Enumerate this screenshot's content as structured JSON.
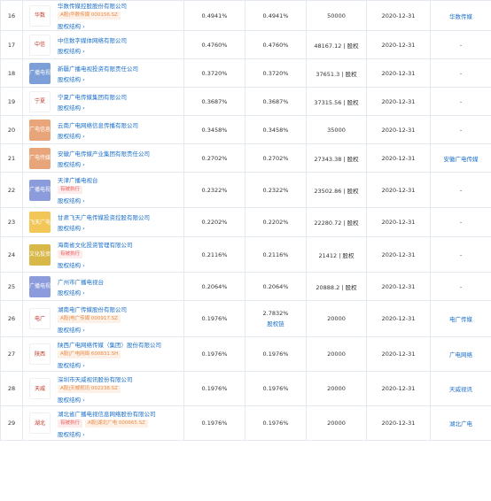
{
  "columns_note": "",
  "rows": [
    {
      "no": "16",
      "logo": "华数",
      "logo_color": "#ffffff",
      "company": "华数传媒控股股份有限公司",
      "tags": [
        {
          "type": "stock",
          "text": "A股|华数传媒 000156.SZ"
        }
      ],
      "chain": "股权结构",
      "ratio1": "0.4941%",
      "ratio2": "0.4941%",
      "ratio2_sub": "",
      "amount": "50000",
      "date": "2020-12-31",
      "brand": "华数传媒"
    },
    {
      "no": "17",
      "logo": "中信",
      "logo_color": "#ffffff",
      "company": "中信数字媒体网络有限公司",
      "tags": [],
      "chain": "股权结构",
      "ratio1": "0.4760%",
      "ratio2": "0.4760%",
      "ratio2_sub": "",
      "amount": "48167.12 | 股权",
      "date": "2020-12-31",
      "brand": "-"
    },
    {
      "no": "18",
      "logo": "广播电视",
      "logo_color": "#7b9fd6",
      "company": "新疆广播电视投资有限责任公司",
      "tags": [],
      "chain": "股权结构",
      "ratio1": "0.3720%",
      "ratio2": "0.3720%",
      "ratio2_sub": "",
      "amount": "37651.3 | 股权",
      "date": "2020-12-31",
      "brand": "-"
    },
    {
      "no": "19",
      "logo": "宁夏",
      "logo_color": "#ffffff",
      "company": "宁夏广电传媒集团有限公司",
      "tags": [],
      "chain": "股权结构",
      "ratio1": "0.3687%",
      "ratio2": "0.3687%",
      "ratio2_sub": "",
      "amount": "37315.56 | 股权",
      "date": "2020-12-31",
      "brand": "-"
    },
    {
      "no": "20",
      "logo": "广电信息",
      "logo_color": "#e9a57a",
      "company": "云南广电网络信息传播有限公司",
      "tags": [],
      "chain": "股权结构",
      "ratio1": "0.3458%",
      "ratio2": "0.3458%",
      "ratio2_sub": "",
      "amount": "35000",
      "date": "2020-12-31",
      "brand": "-"
    },
    {
      "no": "21",
      "logo": "广电传媒",
      "logo_color": "#e9a57a",
      "company": "安徽广电传媒产业集团有限责任公司",
      "tags": [],
      "chain": "股权结构",
      "ratio1": "0.2702%",
      "ratio2": "0.2702%",
      "ratio2_sub": "",
      "amount": "27343.38 | 股权",
      "date": "2020-12-31",
      "brand": "安徽广电传媒"
    },
    {
      "no": "22",
      "logo": "广播电视",
      "logo_color": "#8c9bdb",
      "company": "天津广播电视台",
      "tags": [
        {
          "type": "exec",
          "text": "有被执行"
        }
      ],
      "chain": "股权结构",
      "ratio1": "0.2322%",
      "ratio2": "0.2322%",
      "ratio2_sub": "",
      "amount": "23502.86 | 股权",
      "date": "2020-12-31",
      "brand": "-"
    },
    {
      "no": "23",
      "logo": "飞天广电",
      "logo_color": "#f2c757",
      "company": "甘肃飞天广电传媒投资控股有限公司",
      "tags": [],
      "chain": "股权结构",
      "ratio1": "0.2202%",
      "ratio2": "0.2202%",
      "ratio2_sub": "",
      "amount": "22280.72 | 股权",
      "date": "2020-12-31",
      "brand": "-"
    },
    {
      "no": "24",
      "logo": "文化投资",
      "logo_color": "#d9b84a",
      "company": "海南省文化投资管理有限公司",
      "tags": [
        {
          "type": "exec",
          "text": "有被执行"
        }
      ],
      "chain": "股权结构",
      "ratio1": "0.2116%",
      "ratio2": "0.2116%",
      "ratio2_sub": "",
      "amount": "21412 | 股权",
      "date": "2020-12-31",
      "brand": "-"
    },
    {
      "no": "25",
      "logo": "广播电视",
      "logo_color": "#8c9bdb",
      "company": "广州市广播电视台",
      "tags": [],
      "chain": "股权结构",
      "ratio1": "0.2064%",
      "ratio2": "0.2064%",
      "ratio2_sub": "",
      "amount": "20888.2 | 股权",
      "date": "2020-12-31",
      "brand": "-"
    },
    {
      "no": "26",
      "logo": "电广",
      "logo_color": "#ffffff",
      "company": "湖南电广传媒股份有限公司",
      "tags": [
        {
          "type": "stock",
          "text": "A股|电广传媒 000917.SZ"
        }
      ],
      "chain": "股权结构",
      "ratio1": "0.1976%",
      "ratio2": "2.7832%",
      "ratio2_sub": "股权链",
      "amount": "20000",
      "date": "2020-12-31",
      "brand": "电广传媒"
    },
    {
      "no": "27",
      "logo": "陕西",
      "logo_color": "#ffffff",
      "company": "陕西广电网络传媒（集团）股份有限公司",
      "tags": [
        {
          "type": "stock",
          "text": "A股|广电网络 600831.SH"
        }
      ],
      "chain": "股权结构",
      "ratio1": "0.1976%",
      "ratio2": "0.1976%",
      "ratio2_sub": "",
      "amount": "20000",
      "date": "2020-12-31",
      "brand": "广电网络"
    },
    {
      "no": "28",
      "logo": "天威",
      "logo_color": "#ffffff",
      "company": "深圳市天威视讯股份有限公司",
      "tags": [
        {
          "type": "stock",
          "text": "A股|天威视讯 002238.SZ"
        }
      ],
      "chain": "股权结构",
      "ratio1": "0.1976%",
      "ratio2": "0.1976%",
      "ratio2_sub": "",
      "amount": "20000",
      "date": "2020-12-31",
      "brand": "天威视讯"
    },
    {
      "no": "29",
      "logo": "湖北",
      "logo_color": "#ffffff",
      "company": "湖北省广播电视信息网络股份有限公司",
      "tags": [
        {
          "type": "exec",
          "text": "有被执行"
        },
        {
          "type": "stock",
          "text": "A股|湖北广电 000665.SZ"
        }
      ],
      "chain": "股权结构",
      "ratio1": "0.1976%",
      "ratio2": "0.1976%",
      "ratio2_sub": "",
      "amount": "20000",
      "date": "2020-12-31",
      "brand": "湖北广电"
    }
  ]
}
